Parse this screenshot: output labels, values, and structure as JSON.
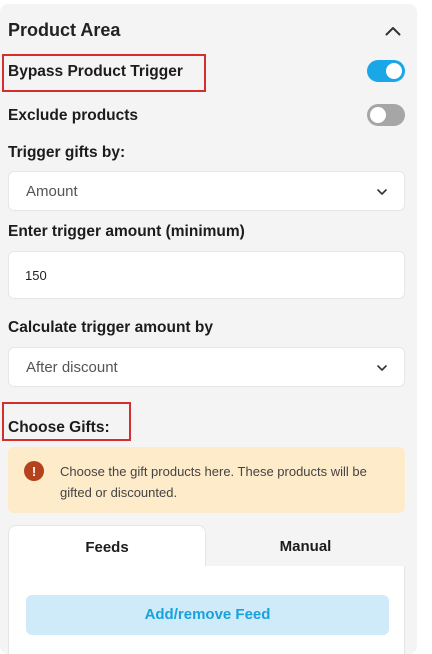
{
  "header": {
    "title": "Product Area",
    "collapse_icon": "chevron-up-icon"
  },
  "bypass_trigger": {
    "label": "Bypass Product Trigger",
    "enabled": true
  },
  "exclude_products": {
    "label": "Exclude products",
    "enabled": false
  },
  "trigger_gifts_by": {
    "label": "Trigger gifts by:",
    "value": "Amount"
  },
  "trigger_amount": {
    "label": "Enter trigger amount (minimum)",
    "value": "150"
  },
  "calculate_by": {
    "label": "Calculate trigger amount by",
    "value": "After discount"
  },
  "choose_gifts": {
    "label": "Choose Gifts:"
  },
  "alert": {
    "icon": "exclamation-icon",
    "text": "Choose the gift products here. These products will be gifted or discounted."
  },
  "tabs": [
    {
      "label": "Feeds",
      "active": true
    },
    {
      "label": "Manual",
      "active": false
    }
  ],
  "feeds": {
    "add_button_label": "Add/remove Feed"
  },
  "colors": {
    "toggle_on": "#1aa7e8",
    "toggle_off": "#a6a6a6",
    "highlight": "#d32f2f",
    "alert_bg": "#fdebc9",
    "alert_icon": "#b5421c",
    "button_bg": "#cfeaf9",
    "button_text": "#18a2dc"
  }
}
